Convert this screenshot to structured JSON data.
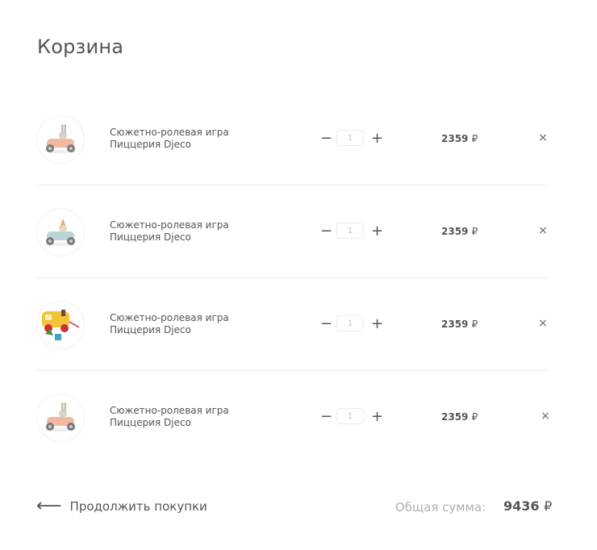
{
  "page": {
    "title": "Корзина"
  },
  "cart": {
    "items": [
      {
        "name": "Сюжетно-ролевая игра Пиццерия Djeco",
        "quantity": "1",
        "price": "2359",
        "currency": "₽",
        "remove": "×",
        "image_icon": "pink-bunny-car-icon"
      },
      {
        "name": "Сюжетно-ролевая игра Пиццерия Djeco",
        "quantity": "1",
        "price": "2359",
        "currency": "₽",
        "remove": "×",
        "image_icon": "blue-car-icon"
      },
      {
        "name": "Сюжетно-ролевая игра Пиццерия Djeco",
        "quantity": "1",
        "price": "2359",
        "currency": "₽",
        "remove": "×",
        "image_icon": "shape-sorter-truck-icon"
      },
      {
        "name": "Сюжетно-ролевая игра Пиццерия Djeco",
        "quantity": "1",
        "price": "2359",
        "currency": "₽",
        "remove": "×",
        "image_icon": "pink-bunny-car-icon"
      }
    ],
    "minus_symbol": "−",
    "plus_symbol": "+"
  },
  "footer": {
    "continue_arrow": "⟵",
    "continue_label": "Продолжить покупки",
    "total_label": "Общая сумма:",
    "total_value": "9436",
    "total_currency": "₽"
  }
}
